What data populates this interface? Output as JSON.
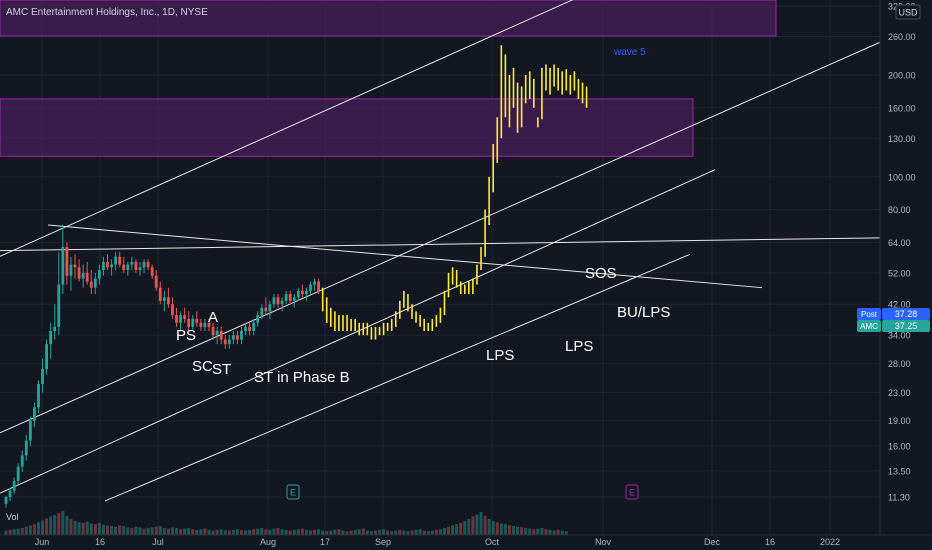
{
  "header": {
    "title": "AMC Entertainment Holdings, Inc., 1D, NYSE",
    "currency": "USD"
  },
  "colors": {
    "background": "#131722",
    "grid": "#1f2433",
    "up": "#26a69a",
    "down": "#ef5350",
    "highlight": "#ffeb3b",
    "zone_fill": "#4a1f5c",
    "zone_stroke": "#9c27b0",
    "line": "#e8e8e8",
    "axis_text": "#b2b5be",
    "label_blue": "#2962ff",
    "label_teal": "#26a69a"
  },
  "chart_data": {
    "type": "candlestick",
    "symbol": "AMC",
    "timeframe": "1D",
    "scale": "log",
    "x_tick_labels": [
      "Jun",
      "16",
      "Jul",
      "Aug",
      "17",
      "Sep",
      "Oct",
      "Nov",
      "Dec",
      "16",
      "2022"
    ],
    "y_tick_labels": [
      "320.00",
      "260.00",
      "200.00",
      "160.00",
      "130.00",
      "100.00",
      "80.00",
      "64.00",
      "52.00",
      "42.00",
      "34.00",
      "28.00",
      "23.00",
      "19.00",
      "16.00",
      "13.50",
      "11.30"
    ],
    "price_labels": {
      "post": {
        "label": "Post",
        "value": "37.28"
      },
      "last": {
        "label": "AMC",
        "value": "37.25"
      }
    },
    "annotations": [
      "wave 5",
      "PS",
      "A",
      "SC",
      "ST",
      "ST in Phase B",
      "LPS",
      "LPS",
      "SOS",
      "BU/LPS"
    ],
    "earnings_markers": [
      "E",
      "E"
    ],
    "volume_label": "Vol",
    "series": [
      {
        "ohlc": [
          [
            10.8,
            11.4,
            10.5,
            11.3
          ],
          [
            11.3,
            12.0,
            11.0,
            11.8
          ],
          [
            11.8,
            12.9,
            11.5,
            12.6
          ],
          [
            12.6,
            14.2,
            12.3,
            13.9
          ],
          [
            13.9,
            15.5,
            13.4,
            15.0
          ],
          [
            15.0,
            17.2,
            14.5,
            16.6
          ],
          [
            16.6,
            19.5,
            16.0,
            19.0
          ],
          [
            19.0,
            21.5,
            18.2,
            20.8
          ],
          [
            20.8,
            25.0,
            20.0,
            24.4
          ],
          [
            24.4,
            29.0,
            23.0,
            27.0
          ],
          [
            27.0,
            33.0,
            26.0,
            32.0
          ],
          [
            32.0,
            37.0,
            29.0,
            35.0
          ],
          [
            35.0,
            42.0,
            33.0,
            36.0
          ],
          [
            36.0,
            60.0,
            34.0,
            48.0
          ],
          [
            48.0,
            72.0,
            45.0,
            62.0
          ],
          [
            62.0,
            64.0,
            48.0,
            51.0
          ],
          [
            51.0,
            58.0,
            46.0,
            55.0
          ],
          [
            55.0,
            59.0,
            50.0,
            54.0
          ],
          [
            54.0,
            57.0,
            49.0,
            50.0
          ],
          [
            50.0,
            55.0,
            47.0,
            52.0
          ],
          [
            52.0,
            56.0,
            48.0,
            49.0
          ],
          [
            49.0,
            53.0,
            45.0,
            47.0
          ],
          [
            47.0,
            52.0,
            45.0,
            50.0
          ],
          [
            50.0,
            55.0,
            48.0,
            53.0
          ],
          [
            53.0,
            58.0,
            51.0,
            56.0
          ],
          [
            56.0,
            59.0,
            53.0,
            54.0
          ],
          [
            54.0,
            57.0,
            51.0,
            55.0
          ],
          [
            55.0,
            60.0,
            53.0,
            58.0
          ],
          [
            58.0,
            60.0,
            54.0,
            55.0
          ],
          [
            55.0,
            58.0,
            52.0,
            53.0
          ],
          [
            53.0,
            56.0,
            51.0,
            55.0
          ],
          [
            55.0,
            58.0,
            53.0,
            56.0
          ],
          [
            56.0,
            57.0,
            52.0,
            53.0
          ],
          [
            53.0,
            56.0,
            51.0,
            54.0
          ],
          [
            54.0,
            57.0,
            52.0,
            56.0
          ],
          [
            56.0,
            57.0,
            53.0,
            54.0
          ],
          [
            54.0,
            55.0,
            50.0,
            51.0
          ],
          [
            51.0,
            53.0,
            46.0,
            47.0
          ],
          [
            47.0,
            49.0,
            42.0,
            43.0
          ],
          [
            43.0,
            46.0,
            40.0,
            44.0
          ],
          [
            44.0,
            47.0,
            41.0,
            42.0
          ],
          [
            42.0,
            44.0,
            38.0,
            39.0
          ],
          [
            39.0,
            41.0,
            36.0,
            37.0
          ],
          [
            37.0,
            40.0,
            35.0,
            39.0
          ],
          [
            39.0,
            41.0,
            37.0,
            38.0
          ],
          [
            38.0,
            40.0,
            35.0,
            36.0
          ],
          [
            36.0,
            39.0,
            35.0,
            38.0
          ],
          [
            38.0,
            40.0,
            36.0,
            37.0
          ],
          [
            37.0,
            38.0,
            35.0,
            36.0
          ],
          [
            36.0,
            38.0,
            35.0,
            37.0
          ],
          [
            37.0,
            38.0,
            35.0,
            36.0
          ],
          [
            36.0,
            37.0,
            33.0,
            34.0
          ],
          [
            34.0,
            36.0,
            32.0,
            35.0
          ],
          [
            35.0,
            36.0,
            32.0,
            33.0
          ],
          [
            33.0,
            34.0,
            31.0,
            32.0
          ],
          [
            32.0,
            34.0,
            31.0,
            33.0
          ],
          [
            33.0,
            35.0,
            32.0,
            34.0
          ],
          [
            34.0,
            35.0,
            32.0,
            33.0
          ],
          [
            33.0,
            36.0,
            32.0,
            35.0
          ],
          [
            35.0,
            37.0,
            34.0,
            36.0
          ],
          [
            36.0,
            37.0,
            34.0,
            35.0
          ],
          [
            35.0,
            38.0,
            34.0,
            37.0
          ],
          [
            37.0,
            40.0,
            36.0,
            39.0
          ],
          [
            39.0,
            42.0,
            38.0,
            41.0
          ],
          [
            41.0,
            44.0,
            39.0,
            40.0
          ],
          [
            40.0,
            43.0,
            38.0,
            42.0
          ],
          [
            42.0,
            45.0,
            41.0,
            44.0
          ],
          [
            44.0,
            45.0,
            41.0,
            42.0
          ],
          [
            42.0,
            44.0,
            40.0,
            43.0
          ],
          [
            43.0,
            46.0,
            42.0,
            45.0
          ],
          [
            45.0,
            46.0,
            42.0,
            43.0
          ],
          [
            43.0,
            45.0,
            41.0,
            44.0
          ],
          [
            44.0,
            47.0,
            43.0,
            46.0
          ],
          [
            46.0,
            48.0,
            44.0,
            45.0
          ],
          [
            45.0,
            47.0,
            43.0,
            46.0
          ],
          [
            46.0,
            49.0,
            45.0,
            48.0
          ],
          [
            48.0,
            50.0,
            46.0,
            49.0
          ],
          [
            49.0,
            50.0,
            45.0,
            46.0
          ]
        ],
        "highlighted_ohlc": [
          [
            46.0,
            47.0,
            40.0,
            42.0
          ],
          [
            42.0,
            44.0,
            37.0,
            39.0
          ],
          [
            39.0,
            41.0,
            36.0,
            37.0
          ],
          [
            37.0,
            40.0,
            35.0,
            38.0
          ],
          [
            38.0,
            39.0,
            35.0,
            36.0
          ],
          [
            36.0,
            39.0,
            35.0,
            38.0
          ],
          [
            38.0,
            39.0,
            35.0,
            36.0
          ],
          [
            36.0,
            38.0,
            35.0,
            37.0
          ],
          [
            37.0,
            38.0,
            35.0,
            36.0
          ],
          [
            36.0,
            37.0,
            34.0,
            35.0
          ],
          [
            35.0,
            37.0,
            34.0,
            36.0
          ],
          [
            36.0,
            37.0,
            34.0,
            35.0
          ],
          [
            35.0,
            36.0,
            33.0,
            34.0
          ],
          [
            34.0,
            36.0,
            33.0,
            35.0
          ],
          [
            35.0,
            36.0,
            34.0,
            35.0
          ],
          [
            35.0,
            37.0,
            34.0,
            36.0
          ],
          [
            36.0,
            37.0,
            35.0,
            36.0
          ],
          [
            36.0,
            38.0,
            35.0,
            37.0
          ],
          [
            37.0,
            40.0,
            36.0,
            39.0
          ],
          [
            39.0,
            43.0,
            38.0,
            42.0
          ],
          [
            42.0,
            46.0,
            41.0,
            44.0
          ],
          [
            44.0,
            45.0,
            40.0,
            41.0
          ],
          [
            41.0,
            42.0,
            38.0,
            39.0
          ],
          [
            39.0,
            40.0,
            37.0,
            38.0
          ],
          [
            38.0,
            39.0,
            36.0,
            37.0
          ],
          [
            37.0,
            38.0,
            35.0,
            36.0
          ],
          [
            36.0,
            37.0,
            35.0,
            36.0
          ],
          [
            36.0,
            38.0,
            35.0,
            37.0
          ],
          [
            37.0,
            39.0,
            36.0,
            38.0
          ],
          [
            38.0,
            41.0,
            37.0,
            40.0
          ],
          [
            40.0,
            46.0,
            39.0,
            45.0
          ],
          [
            45.0,
            52.0,
            44.0,
            50.0
          ],
          [
            50.0,
            54.0,
            48.0,
            52.0
          ],
          [
            52.0,
            53.0,
            47.0,
            48.0
          ],
          [
            48.0,
            49.0,
            45.0,
            46.0
          ],
          [
            46.0,
            48.0,
            45.0,
            47.0
          ],
          [
            47.0,
            49.0,
            45.0,
            46.0
          ],
          [
            46.0,
            50.0,
            45.0,
            49.0
          ],
          [
            49.0,
            55.0,
            48.0,
            54.0
          ],
          [
            54.0,
            62.0,
            53.0,
            60.0
          ],
          [
            60.0,
            80.0,
            58.0,
            76.0
          ],
          [
            76.0,
            100.0,
            72.0,
            95.0
          ],
          [
            95.0,
            125.0,
            90.0,
            118.0
          ],
          [
            118.0,
            150.0,
            110.0,
            140.0
          ],
          [
            140.0,
            245.0,
            130.0,
            215.0
          ],
          [
            215.0,
            230.0,
            150.0,
            165.0
          ],
          [
            165.0,
            200.0,
            140.0,
            180.0
          ],
          [
            180.0,
            210.0,
            160.0,
            170.0
          ],
          [
            170.0,
            190.0,
            135.0,
            145.0
          ],
          [
            145.0,
            185.0,
            140.0,
            175.0
          ],
          [
            175.0,
            200.0,
            165.0,
            190.0
          ],
          [
            190.0,
            205.0,
            170.0,
            180.0
          ],
          [
            180.0,
            195.0,
            160.0,
            165.0
          ],
          [
            165.0,
            150.0,
            140.0,
            150.0
          ],
          [
            150.0,
            210.0,
            148.0,
            200.0
          ],
          [
            200.0,
            215.0,
            180.0,
            190.0
          ],
          [
            190.0,
            210.0,
            175.0,
            200.0
          ],
          [
            200.0,
            215.0,
            185.0,
            195.0
          ],
          [
            195.0,
            210.0,
            180.0,
            185.0
          ],
          [
            185.0,
            205.0,
            175.0,
            200.0
          ],
          [
            200.0,
            208.0,
            180.0,
            185.0
          ],
          [
            185.0,
            200.0,
            175.0,
            195.0
          ],
          [
            195.0,
            205.0,
            180.0,
            185.0
          ],
          [
            185.0,
            195.0,
            170.0,
            175.0
          ],
          [
            175.0,
            190.0,
            165.0,
            180.0
          ],
          [
            180.0,
            185.0,
            160.0,
            165.0
          ]
        ]
      }
    ],
    "volume": [
      14,
      16,
      18,
      20,
      22,
      26,
      30,
      34,
      40,
      46,
      52,
      58,
      62,
      70,
      75,
      60,
      50,
      44,
      40,
      38,
      42,
      36,
      34,
      38,
      32,
      30,
      28,
      26,
      30,
      28,
      24,
      22,
      26,
      24,
      20,
      22,
      24,
      26,
      28,
      22,
      20,
      24,
      22,
      18,
      20,
      22,
      18,
      16,
      18,
      20,
      16,
      14,
      16,
      18,
      15,
      14,
      16,
      18,
      15,
      14,
      16,
      18,
      20,
      22,
      18,
      16,
      20,
      22,
      18,
      16,
      14,
      16,
      18,
      20,
      16,
      14,
      16,
      18,
      14,
      12,
      14,
      16,
      18,
      14,
      12,
      14,
      16,
      18,
      20,
      14,
      12,
      14,
      16,
      18,
      14,
      12,
      14,
      16,
      14,
      12,
      14,
      16,
      18,
      14,
      12,
      14,
      16,
      18,
      22,
      26,
      30,
      34,
      38,
      44,
      50,
      58,
      64,
      72,
      60,
      50,
      44,
      40,
      36,
      34,
      30,
      28,
      26,
      24,
      22,
      20,
      18,
      20,
      22,
      18,
      16,
      14,
      16,
      14,
      12
    ]
  }
}
